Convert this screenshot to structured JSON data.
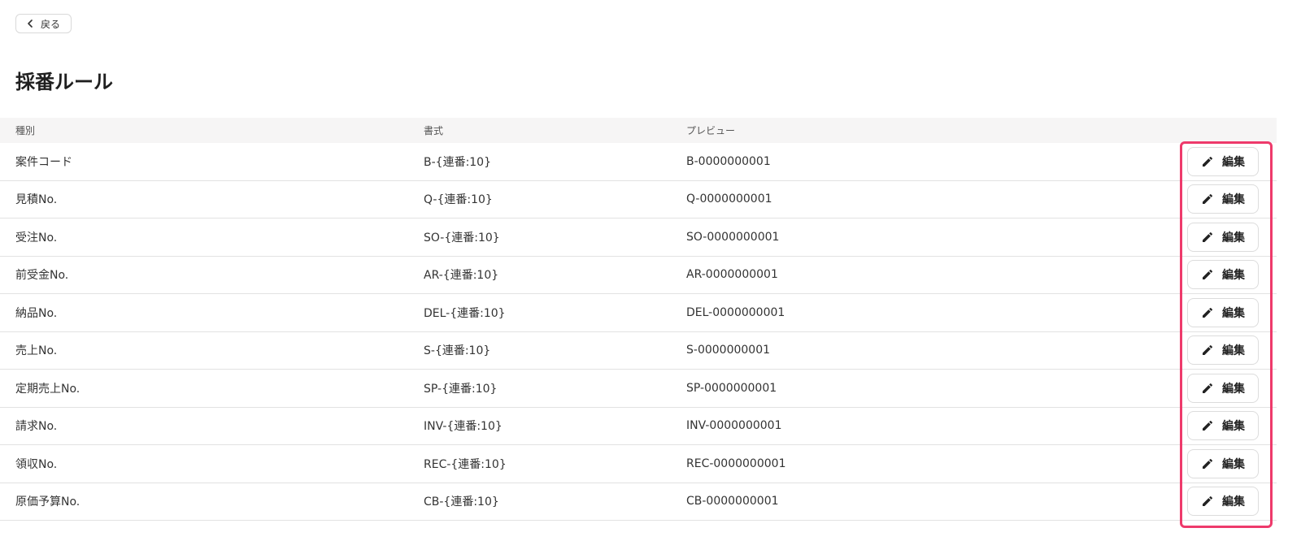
{
  "back_button": {
    "label": "戻る",
    "icon": "chevron-left-icon"
  },
  "page_title": "採番ルール",
  "table": {
    "headers": {
      "type": "種別",
      "format": "書式",
      "preview": "プレビュー"
    },
    "edit_label": "編集",
    "edit_icon": "pencil-icon",
    "rows": [
      {
        "type": "案件コード",
        "format": "B-{連番:10}",
        "preview": "B-0000000001"
      },
      {
        "type": "見積No.",
        "format": "Q-{連番:10}",
        "preview": "Q-0000000001"
      },
      {
        "type": "受注No.",
        "format": "SO-{連番:10}",
        "preview": "SO-0000000001"
      },
      {
        "type": "前受金No.",
        "format": "AR-{連番:10}",
        "preview": "AR-0000000001"
      },
      {
        "type": "納品No.",
        "format": "DEL-{連番:10}",
        "preview": "DEL-0000000001"
      },
      {
        "type": "売上No.",
        "format": "S-{連番:10}",
        "preview": "S-0000000001"
      },
      {
        "type": "定期売上No.",
        "format": "SP-{連番:10}",
        "preview": "SP-0000000001"
      },
      {
        "type": "請求No.",
        "format": "INV-{連番:10}",
        "preview": "INV-0000000001"
      },
      {
        "type": "領収No.",
        "format": "REC-{連番:10}",
        "preview": "REC-0000000001"
      },
      {
        "type": "原価予算No.",
        "format": "CB-{連番:10}",
        "preview": "CB-0000000001"
      }
    ]
  },
  "highlight_color": "#ee3a6b"
}
